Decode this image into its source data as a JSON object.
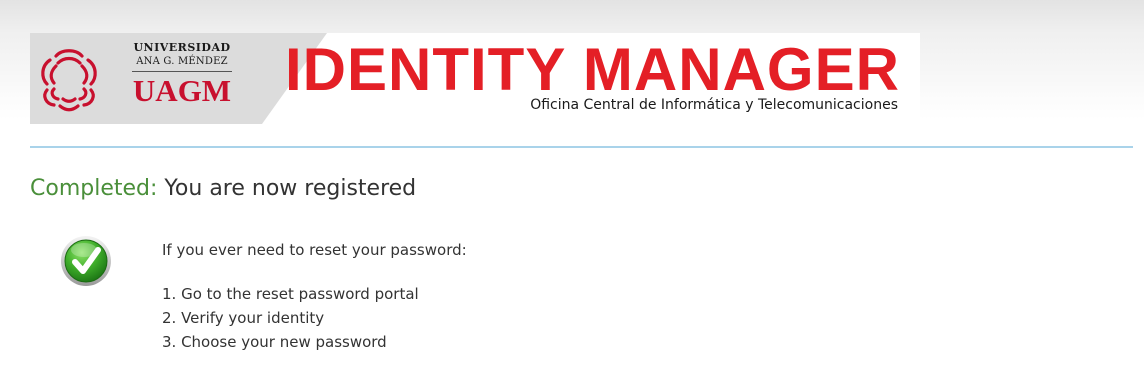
{
  "header": {
    "university_line1": "UNIVERSIDAD",
    "university_line2": "ANA G. MÉNDEZ",
    "university_acronym": "UAGM",
    "product_title": "IDENTITY MANAGER",
    "department": "Oficina Central de Informática y Telecomunicaciones",
    "logo_icon": "uagm-logo-icon",
    "colors": {
      "brand_red": "#e41f26",
      "acronym_red": "#c8102e",
      "divider": "#a9d3ea"
    }
  },
  "main": {
    "status_label": "Completed:",
    "status_message": "You are now registered",
    "status_icon": "check-icon",
    "status_color": "#4a8f3a",
    "intro": "If you ever need to reset your password:",
    "steps": [
      "1. Go to the reset password portal",
      "2. Verify your identity",
      "3. Choose your new password"
    ]
  }
}
